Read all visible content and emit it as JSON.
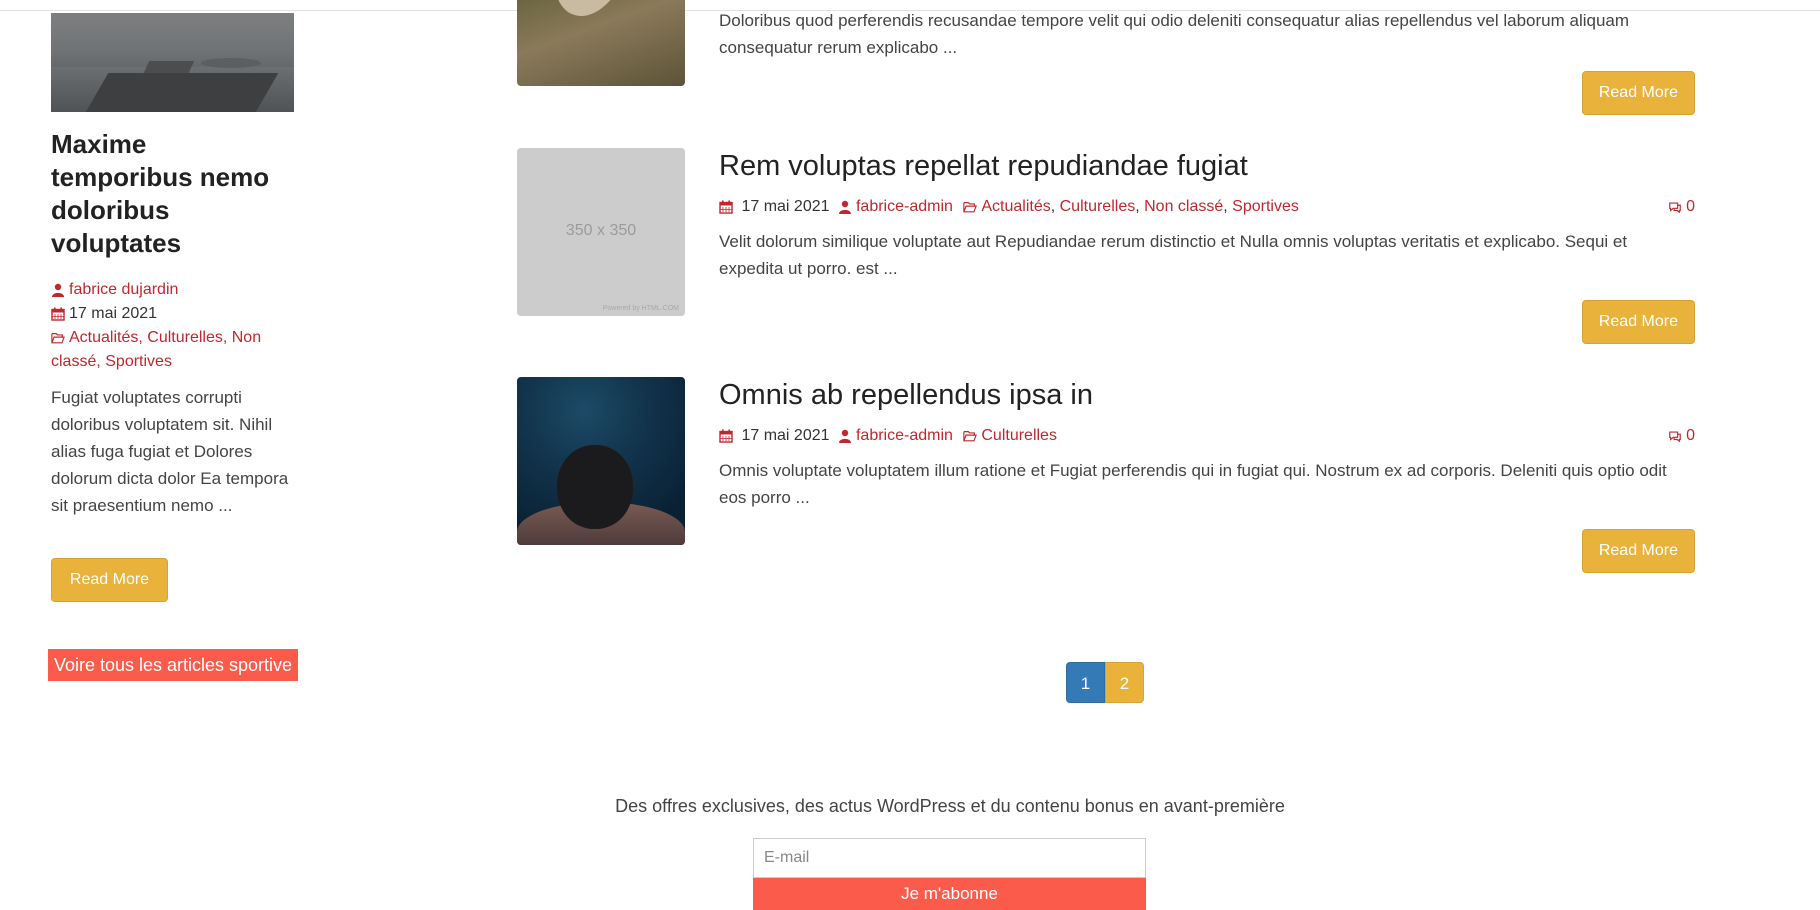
{
  "sidebar": {
    "title": "Maxime temporibus nemo doloribus voluptates",
    "author": "fabrice dujardin",
    "date": "17 mai 2021",
    "categories": [
      "Actualités",
      "Culturelles",
      "Non classé",
      "Sportives"
    ],
    "excerpt": "Fugiat voluptates corrupti doloribus voluptatem sit. Nihil alias fuga fugiat et Dolores dolorum dicta dolor Ea tempora sit praesentium nemo ...",
    "read_more": "Read More",
    "all_articles": "Voire tous les articles sportive"
  },
  "posts": [
    {
      "excerpt": "Doloribus quod perferendis recusandae tempore velit qui odio deleniti consequatur alias repellendus vel laborum aliquam consequatur rerum explicabo ...",
      "read_more": "Read More"
    },
    {
      "title": "Rem voluptas repellat repudiandae fugiat",
      "date": "17 mai 2021",
      "author": "fabrice-admin",
      "categories": [
        "Actualités",
        "Culturelles",
        "Non classé",
        "Sportives"
      ],
      "comments": "0",
      "excerpt": "Velit dolorum similique voluptate aut Repudiandae rerum distinctio et Nulla omnis voluptas veritatis et explicabo. Sequi et expedita ut porro. est ...",
      "read_more": "Read More",
      "thumb_text": "350 x 350",
      "thumb_credit": "Powered by HTML.COM"
    },
    {
      "title": "Omnis ab repellendus ipsa in",
      "date": "17 mai 2021",
      "author": "fabrice-admin",
      "categories": [
        "Culturelles"
      ],
      "comments": "0",
      "excerpt": "Omnis voluptate voluptatem illum ratione et Fugiat perferendis qui in fugiat qui. Nostrum ex ad corporis. Deleniti quis optio odit eos porro ...",
      "read_more": "Read More"
    }
  ],
  "pagination": {
    "pages": [
      "1",
      "2"
    ],
    "current": "1"
  },
  "newsletter": {
    "text": "Des offres exclusives, des actus WordPress et du contenu bonus en avant-première",
    "email_placeholder": "E-mail",
    "subscribe": "Je m'abonne"
  },
  "icons": {
    "user": "user-icon",
    "calendar": "calendar-icon",
    "folder": "folder-open-icon",
    "comments": "comments-icon"
  },
  "colors": {
    "accent_red": "#c0282d",
    "button_yellow": "#e9b23a",
    "pager_blue": "#337ab7",
    "cta_red": "#fa5b4a"
  }
}
